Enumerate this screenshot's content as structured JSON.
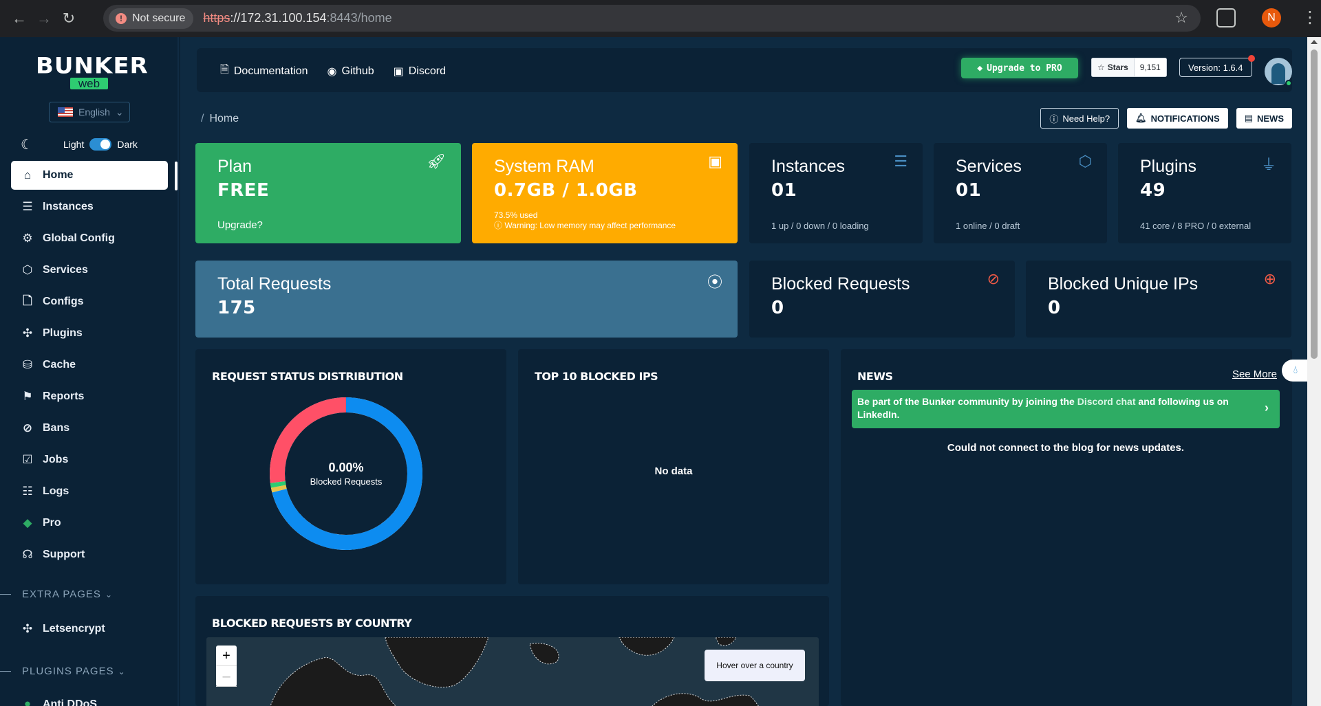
{
  "browser": {
    "security_label": "Not secure",
    "url_scheme": "https",
    "url_host": "://172.31.100.154",
    "url_port_path": ":8443/home",
    "profile_initial": "N"
  },
  "sidebar": {
    "logo_top": "BUNKER",
    "logo_bottom": "web",
    "language": "English",
    "theme_light": "Light",
    "theme_dark": "Dark",
    "items": [
      {
        "label": "Home",
        "icon": "home-icon",
        "glyph": "⌂"
      },
      {
        "label": "Instances",
        "icon": "server-icon",
        "glyph": "☰"
      },
      {
        "label": "Global Config",
        "icon": "gear-icon",
        "glyph": "⚙"
      },
      {
        "label": "Services",
        "icon": "box-icon",
        "glyph": "⬡"
      },
      {
        "label": "Configs",
        "icon": "file-icon",
        "glyph": "🗋"
      },
      {
        "label": "Plugins",
        "icon": "puzzle-icon",
        "glyph": "✣"
      },
      {
        "label": "Cache",
        "icon": "database-icon",
        "glyph": "⛁"
      },
      {
        "label": "Reports",
        "icon": "flag-icon",
        "glyph": "⚑"
      },
      {
        "label": "Bans",
        "icon": "ban-icon",
        "glyph": "⊘"
      },
      {
        "label": "Jobs",
        "icon": "calendar-check-icon",
        "glyph": "☑"
      },
      {
        "label": "Logs",
        "icon": "logs-icon",
        "glyph": "☷"
      },
      {
        "label": "Pro",
        "icon": "diamond-icon",
        "glyph": "◆"
      },
      {
        "label": "Support",
        "icon": "headset-icon",
        "glyph": "☊"
      }
    ],
    "extra_pages_label": "EXTRA PAGES",
    "extra_items": [
      {
        "label": "Letsencrypt",
        "icon": "puzzle-icon"
      }
    ],
    "plugins_pages_label": "PLUGINS PAGES",
    "plugin_items": [
      {
        "label": "Anti DDoS"
      }
    ]
  },
  "topbar": {
    "documentation": "Documentation",
    "github": "Github",
    "discord": "Discord",
    "upgrade": "Upgrade to PRO",
    "stars_label": "Stars",
    "stars_count": "9,151",
    "version": "Version: 1.6.4"
  },
  "breadcrumb": {
    "current": "Home"
  },
  "header_buttons": {
    "help": "Need Help?",
    "notifications": "NOTIFICATIONS",
    "news": "NEWS"
  },
  "cards": {
    "plan": {
      "title": "Plan",
      "value": "FREE",
      "sub": "Upgrade?",
      "color": "#2eac64"
    },
    "ram": {
      "title": "System RAM",
      "value": "0.7GB / 1.0GB",
      "used": "73.5% used",
      "warning": "Warning: Low memory may affect performance",
      "color": "#ffab00"
    },
    "instances": {
      "title": "Instances",
      "value": "01",
      "sub": "1 up / 0 down / 0 loading"
    },
    "services": {
      "title": "Services",
      "value": "01",
      "sub": "1 online / 0 draft"
    },
    "plugins": {
      "title": "Plugins",
      "value": "49",
      "sub": "41 core / 8 PRO / 0 external"
    },
    "total_requests": {
      "title": "Total Requests",
      "value": "175",
      "color": "#3a7090"
    },
    "blocked_requests": {
      "title": "Blocked Requests",
      "value": "0"
    },
    "blocked_ips": {
      "title": "Blocked Unique IPs",
      "value": "0"
    }
  },
  "panels": {
    "status_dist": {
      "title": "REQUEST STATUS DISTRIBUTION",
      "center_value": "0.00%",
      "center_label": "Blocked Requests"
    },
    "top_blocked": {
      "title": "TOP 10 BLOCKED IPS",
      "empty": "No data"
    },
    "news": {
      "title": "NEWS",
      "see_more": "See More",
      "banner_a": "Be part of the Bunker community by joining the ",
      "banner_link1": "Discord chat",
      "banner_b": " and following us on ",
      "banner_link2": "LinkedIn",
      "banner_c": ".",
      "empty": "Could not connect to the blog for news updates."
    },
    "by_country": {
      "title": "BLOCKED REQUESTS BY COUNTRY",
      "hover": "Hover over a country",
      "zoom_in": "+",
      "zoom_out": "–"
    }
  },
  "chart_data": {
    "type": "pie",
    "segments": [
      {
        "value": 71,
        "color": "#0d8cf0"
      },
      {
        "value": 1,
        "color": "#e8c34a"
      },
      {
        "value": 1,
        "color": "#2ecc71"
      },
      {
        "value": 27,
        "color": "#ff5067"
      }
    ]
  }
}
